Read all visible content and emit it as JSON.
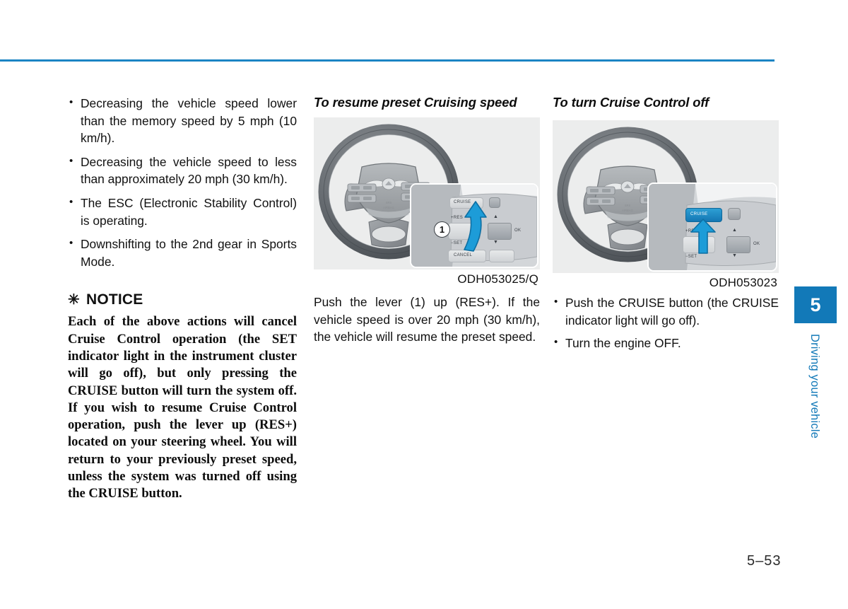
{
  "page": {
    "number": "5–53",
    "rule_color": "#1b84c4"
  },
  "sidebar": {
    "chapter_number": "5",
    "chapter_label": "Driving your vehicle",
    "color": "#1279b8"
  },
  "column_left": {
    "bullets": [
      "Decreasing the vehicle speed lower than the memory speed by 5 mph (10 km/h).",
      "Decreasing the vehicle speed to less than approximately 20 mph (30 km/h).",
      "The ESC (Electronic Stability Control) is operating.",
      "Downshifting to the 2nd gear in Sports Mode."
    ],
    "notice": {
      "star": "✳",
      "title": "NOTICE",
      "body": "Each of the above actions will cancel Cruise Control operation (the SET indicator light in the instrument cluster will go off), but only pressing the CRUISE button will turn the system off. If you wish to resume Cruise Control operation, push the lever up (RES+) located on your steering wheel. You will return to your previously preset speed, unless the system was turned off using the CRUISE button."
    }
  },
  "column_middle": {
    "heading": "To resume preset Cruising speed",
    "figure": {
      "code": "ODH053025/Q",
      "callout_marker": "1",
      "buttons": {
        "cruise": "CRUISE",
        "res": "+RES",
        "set": "−SET",
        "cancel": "CANCEL",
        "ok": "OK",
        "up": "▲",
        "down": "▼"
      }
    },
    "caption": "Push the lever (1) up (RES+). If the vehicle speed is over 20 mph (30 km/h), the vehicle will resume the preset speed."
  },
  "column_right": {
    "heading": "To turn Cruise Control off",
    "figure": {
      "code": "ODH053023",
      "buttons": {
        "cruise": "CRUISE",
        "res": "+RES",
        "set": "−SET",
        "ok": "OK",
        "up": "▲",
        "down": "▼"
      }
    },
    "bullets": [
      "Push the CRUISE button (the CRUISE indicator light will go off).",
      "Turn the engine OFF."
    ]
  }
}
